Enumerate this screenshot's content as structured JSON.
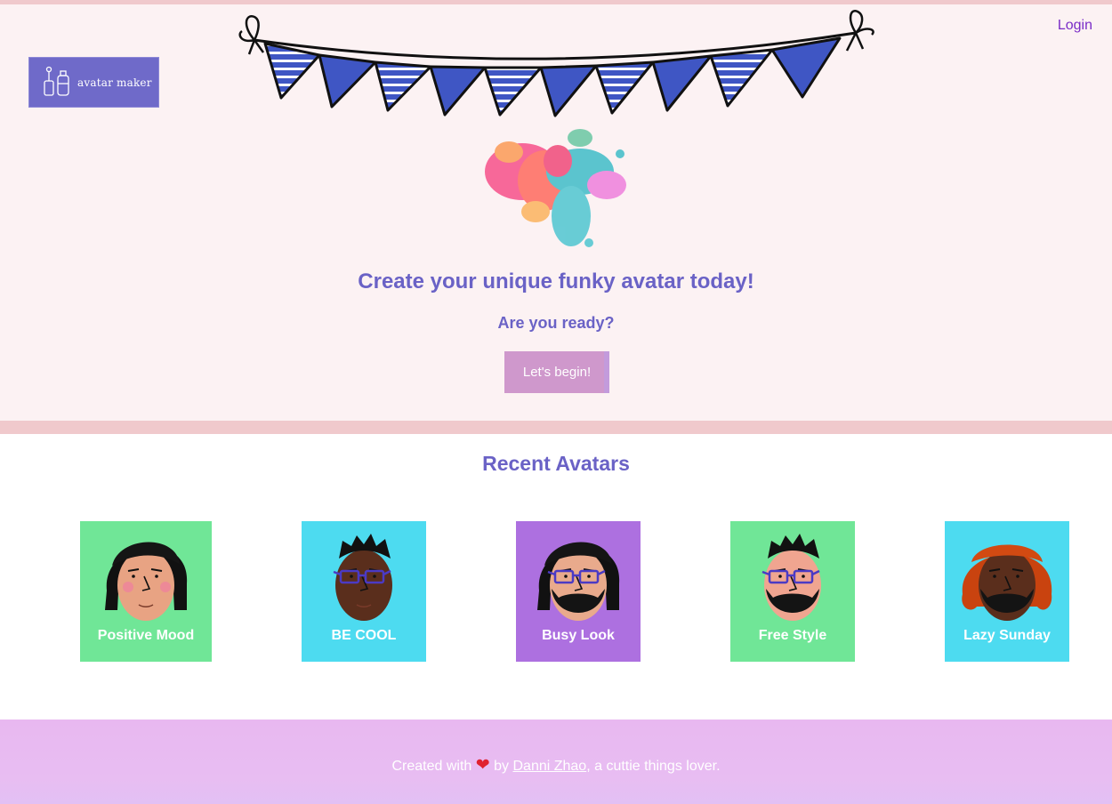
{
  "header": {
    "logo_text": "avatar maker",
    "login_label": "Login"
  },
  "hero": {
    "title": "Create your unique funky avatar today!",
    "subtitle": "Are you ready?",
    "cta_label": "Let's begin!"
  },
  "recent": {
    "title": "Recent Avatars",
    "avatars": [
      {
        "label": "Positive Mood",
        "bg_color": "#70e697",
        "hair": "long-black",
        "skin": "#e8a383",
        "glasses": false,
        "beard": false
      },
      {
        "label": "BE COOL",
        "bg_color": "#4ddbf0",
        "hair": "spiky-black",
        "skin": "#5a2e1c",
        "glasses": true,
        "beard": false
      },
      {
        "label": "Busy Look",
        "bg_color": "#ad70e0",
        "hair": "long-black",
        "skin": "#e9aa8c",
        "glasses": true,
        "beard": true
      },
      {
        "label": "Free Style",
        "bg_color": "#70e697",
        "hair": "spiky-black",
        "skin": "#f0a590",
        "glasses": true,
        "beard": true
      },
      {
        "label": "Lazy Sunday",
        "bg_color": "#4ddbf0",
        "hair": "curly-orange",
        "skin": "#5a2e1c",
        "glasses": false,
        "beard": true
      }
    ]
  },
  "footer": {
    "prefix": "Created with",
    "by": "by",
    "author": "Danni Zhao",
    "suffix": ", a cuttie things lover."
  },
  "colors": {
    "accent": "#6a62c6",
    "hero_bg": "#fcf2f3",
    "divider": "#f0c9cc",
    "button": "#cf98cc",
    "footer": "#e8b8f0",
    "bunting": "#3f56c4"
  }
}
